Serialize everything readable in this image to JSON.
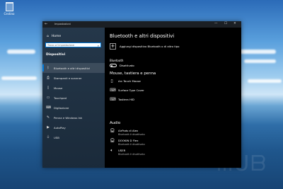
{
  "desktop": {
    "recycle_bin_label": "Cestino"
  },
  "window": {
    "title": "Impostazioni",
    "controls": {
      "minimize": "—",
      "maximize": "☐",
      "close": "✕"
    }
  },
  "sidebar": {
    "home_label": "Home",
    "search_placeholder": "Trova un'impostazione",
    "section_title": "Dispositivi",
    "items": [
      {
        "label": "Bluetooth e altri dispositivi",
        "icon": "bluetooth-icon"
      },
      {
        "label": "Stampanti e scanner",
        "icon": "printer-icon"
      },
      {
        "label": "Mouse",
        "icon": "mouse-icon"
      },
      {
        "label": "Touchpad",
        "icon": "touchpad-icon"
      },
      {
        "label": "Digitazione",
        "icon": "keyboard-icon"
      },
      {
        "label": "Penna e Windows Ink",
        "icon": "pen-icon"
      },
      {
        "label": "AutoPlay",
        "icon": "autoplay-icon"
      },
      {
        "label": "USB",
        "icon": "usb-icon"
      }
    ],
    "selected_index": 0
  },
  "content": {
    "title": "Bluetooth e altri dispositivi",
    "add_device_label": "Aggiungi dispositivo Bluetooth o di altro tipo",
    "bluetooth_label": "Bluetooth",
    "bluetooth_state": "Disattivato",
    "mouse_section_title": "Mouse, tastiera e penna",
    "mouse_devices": [
      {
        "name": "Arc Touch Mouse",
        "icon": "mouse-icon"
      },
      {
        "name": "Surface Type Cover",
        "icon": "keyboard-icon"
      },
      {
        "name": "Tastiera HID",
        "icon": "keyboard-icon"
      }
    ],
    "audio_section_title": "Audio",
    "audio_devices": [
      {
        "name": "AirPods di Alex",
        "status": "Bluetooth è disattivato",
        "icon": "headphones-icon"
      },
      {
        "name": "DOOKIN D Flex",
        "status": "Bluetooth è disattivato",
        "icon": "headphones-icon"
      },
      {
        "name": "USER",
        "status": "Bluetooth è disattivato",
        "icon": "speaker-icon"
      }
    ]
  }
}
